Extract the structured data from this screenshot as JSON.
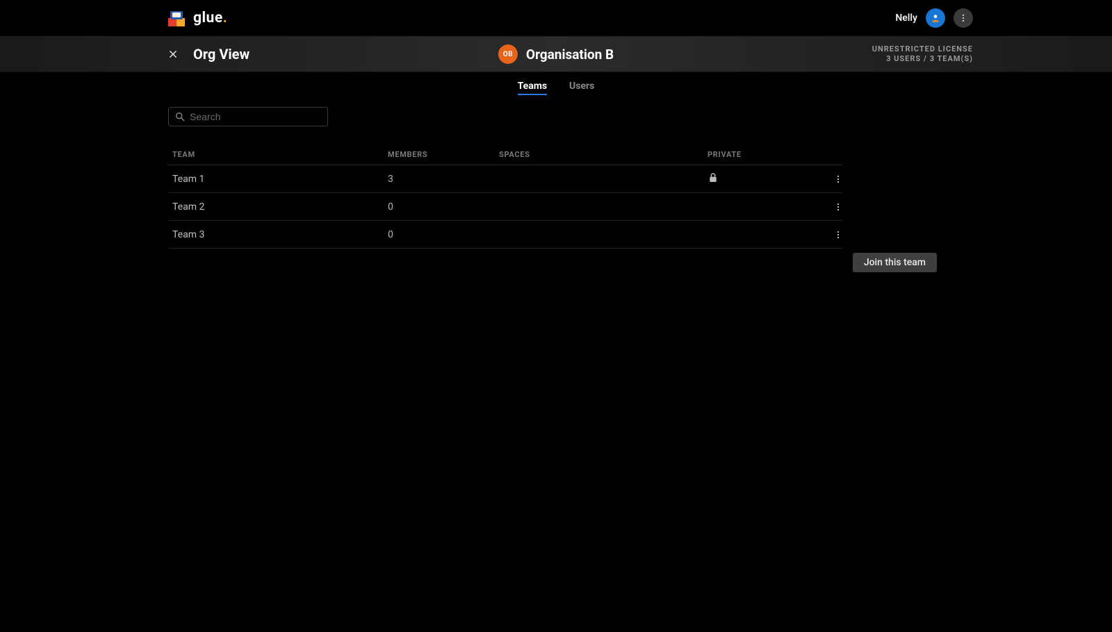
{
  "brand": {
    "name_part1": "glue",
    "name_dot": "."
  },
  "user": {
    "name": "Nelly"
  },
  "page": {
    "title": "Org View"
  },
  "org": {
    "initials": "OB",
    "name": "Organisation B"
  },
  "license": {
    "line1": "UNRESTRICTED LICENSE",
    "line2": "3 USERS / 3 TEAM(S)"
  },
  "tabs": {
    "teams": "Teams",
    "users": "Users"
  },
  "search": {
    "placeholder": "Search"
  },
  "columns": {
    "team": "TEAM",
    "members": "MEMBERS",
    "spaces": "SPACES",
    "private": "PRIVATE"
  },
  "rows": [
    {
      "team": "Team 1",
      "members": "3",
      "spaces": "",
      "private": true
    },
    {
      "team": "Team 2",
      "members": "0",
      "spaces": "",
      "private": false
    },
    {
      "team": "Team 3",
      "members": "0",
      "spaces": "",
      "private": false
    }
  ],
  "popover": {
    "join": "Join this team"
  }
}
